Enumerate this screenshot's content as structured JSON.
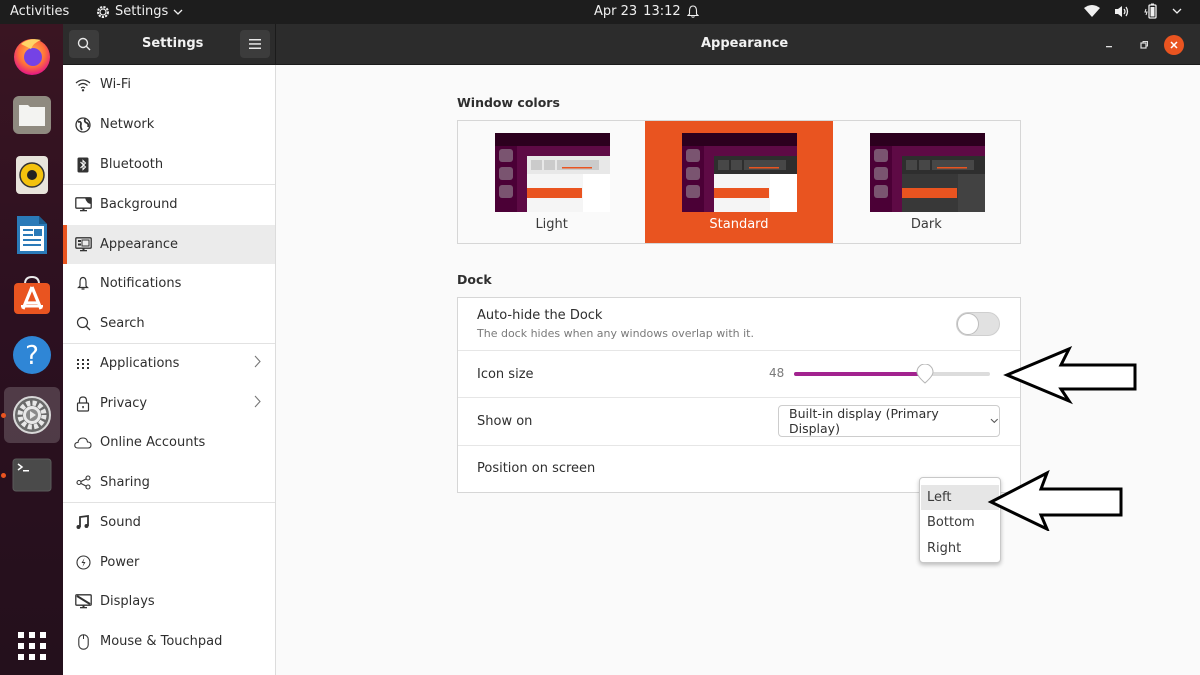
{
  "topbar": {
    "activities": "Activities",
    "app_menu": "Settings",
    "date": "Apr 23",
    "time": "13:12",
    "tray_icons": [
      "wifi-icon",
      "volume-icon",
      "battery-icon",
      "system-menu-chevron-icon"
    ]
  },
  "dock": {
    "items": [
      {
        "name": "firefox",
        "icon": "firefox-icon",
        "running": false
      },
      {
        "name": "files",
        "icon": "files-icon",
        "running": false
      },
      {
        "name": "rhythmbox",
        "icon": "rhythmbox-icon",
        "running": false
      },
      {
        "name": "libreoffice-writer",
        "icon": "writer-icon",
        "running": false
      },
      {
        "name": "software",
        "icon": "software-store-icon",
        "running": false
      },
      {
        "name": "help",
        "icon": "help-icon",
        "running": false
      },
      {
        "name": "settings",
        "icon": "settings-icon",
        "running": true,
        "active": true
      },
      {
        "name": "terminal",
        "icon": "terminal-icon",
        "running": true
      }
    ],
    "show_apps_icon": "app-grid-icon"
  },
  "window": {
    "sidebar_title": "Settings",
    "page_title": "Appearance",
    "controls": [
      "minimize",
      "maximize",
      "close"
    ]
  },
  "sidebar": {
    "items": [
      {
        "label": "Wi-Fi",
        "icon": "wifi-icon"
      },
      {
        "label": "Network",
        "icon": "globe-icon"
      },
      {
        "label": "Bluetooth",
        "icon": "bluetooth-icon"
      },
      {
        "label": "Background",
        "icon": "background-icon"
      },
      {
        "label": "Appearance",
        "icon": "appearance-icon",
        "selected": true
      },
      {
        "label": "Notifications",
        "icon": "bell-icon"
      },
      {
        "label": "Search",
        "icon": "search-icon"
      },
      {
        "label": "Applications",
        "icon": "grid-icon",
        "chevron": true
      },
      {
        "label": "Privacy",
        "icon": "lock-icon",
        "chevron": true
      },
      {
        "label": "Online Accounts",
        "icon": "cloud-icon"
      },
      {
        "label": "Sharing",
        "icon": "share-icon"
      },
      {
        "label": "Sound",
        "icon": "music-note-icon"
      },
      {
        "label": "Power",
        "icon": "power-icon"
      },
      {
        "label": "Displays",
        "icon": "display-icon"
      },
      {
        "label": "Mouse & Touchpad",
        "icon": "mouse-icon"
      }
    ]
  },
  "appearance": {
    "window_colors": {
      "title": "Window colors",
      "options": [
        {
          "label": "Light",
          "selected": false
        },
        {
          "label": "Standard",
          "selected": true
        },
        {
          "label": "Dark",
          "selected": false
        }
      ]
    },
    "dock": {
      "title": "Dock",
      "auto_hide": {
        "label": "Auto-hide the Dock",
        "description": "The dock hides when any windows overlap with it.",
        "enabled": false
      },
      "icon_size": {
        "label": "Icon size",
        "value": "48",
        "min": 16,
        "max": 64,
        "current": 48
      },
      "show_on": {
        "label": "Show on",
        "value": "Built-in display (Primary Display)"
      },
      "position": {
        "label": "Position on screen",
        "options": [
          "Left",
          "Bottom",
          "Right"
        ],
        "highlighted": "Left"
      }
    }
  },
  "colors": {
    "accent": "#e95420",
    "slider_fill": "#a2238f",
    "headerbar": "#2c2c2c",
    "topbar": "#1d1d1d"
  }
}
